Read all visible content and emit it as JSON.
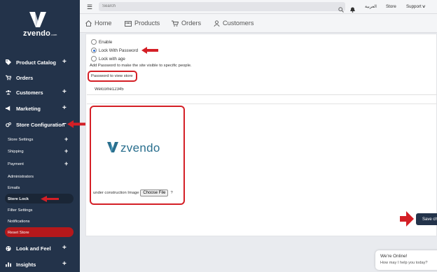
{
  "sidebar": {
    "logo_text": "zvendo",
    "logo_suffix": ".com",
    "items": [
      {
        "label": "Product Catalog",
        "icon": "tag-icon",
        "expandable": "+"
      },
      {
        "label": "Orders",
        "icon": "cart-icon"
      },
      {
        "label": "Customers",
        "icon": "users-icon",
        "expandable": "+"
      },
      {
        "label": "Marketing",
        "icon": "megaphone-icon",
        "expandable": "+"
      },
      {
        "label": "Store Configuration",
        "icon": "gears-icon",
        "expandable": "−"
      },
      {
        "label": "Look and Feel",
        "icon": "palette-icon",
        "expandable": "+"
      },
      {
        "label": "Insights",
        "icon": "chart-icon",
        "expandable": "+"
      }
    ],
    "sub_items": [
      {
        "label": "Store Settings",
        "expandable": "+"
      },
      {
        "label": "Shipping",
        "expandable": "+"
      },
      {
        "label": "Payment",
        "expandable": "+"
      },
      {
        "label": "Administrators"
      },
      {
        "label": "Emails"
      },
      {
        "label": "Store Lock"
      },
      {
        "label": "Filter Settings"
      },
      {
        "label": "Notifications"
      },
      {
        "label": "Reset Store"
      }
    ]
  },
  "topbar": {
    "search_placeholder": "Search",
    "language": "العربية",
    "store": "Store",
    "support": "Support"
  },
  "tabs": [
    {
      "label": "Home",
      "icon": "home-icon"
    },
    {
      "label": "Products",
      "icon": "box-icon"
    },
    {
      "label": "Orders",
      "icon": "cart-icon"
    },
    {
      "label": "Customers",
      "icon": "user-icon"
    }
  ],
  "form": {
    "radio_options": [
      {
        "label": "Enable",
        "checked": false
      },
      {
        "label": "Lock With Password",
        "checked": true
      },
      {
        "label": "Lock with age",
        "checked": false
      }
    ],
    "helper_text": "Add Password to make the site visible to specific people.",
    "password_label": "Password to view store",
    "password_value": "Welcome12345",
    "brand_word": "zvendo",
    "upload_label": "under construction Image",
    "choose_file": "Choose File",
    "question_mark": "?",
    "save_label": "Save ch"
  },
  "chat": {
    "title": "We're Online!",
    "subtitle": "How may I help you today?"
  },
  "colors": {
    "sidebar_bg": "#23334a",
    "accent_red": "#d41f26",
    "reset_red": "#b5181b",
    "brand_teal": "#2a6f8e"
  }
}
